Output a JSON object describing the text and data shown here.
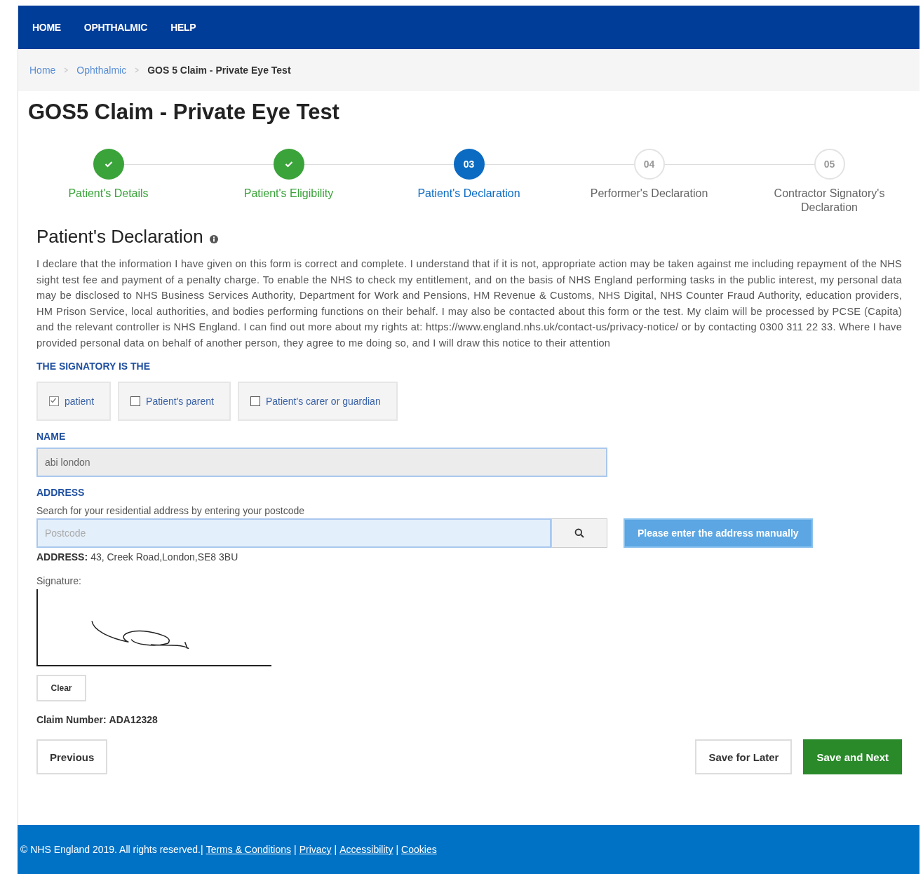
{
  "nav": {
    "items": [
      "HOME",
      "OPHTHALMIC",
      "HELP"
    ]
  },
  "breadcrumb": {
    "items": [
      {
        "label": "Home",
        "current": false
      },
      {
        "label": "Ophthalmic",
        "current": false
      },
      {
        "label": "GOS 5 Claim - Private Eye Test",
        "current": true
      }
    ]
  },
  "title": "GOS5 Claim - Private Eye Test",
  "steps": [
    {
      "label": "Patient's Details",
      "completed": true,
      "selected": false
    },
    {
      "label": "Patient's Eligibility",
      "completed": true,
      "selected": false
    },
    {
      "label": "Patient's Declaration",
      "number": "03",
      "completed": false,
      "selected": true
    },
    {
      "label": "Performer's Declaration",
      "number": "04",
      "completed": false,
      "selected": false
    },
    {
      "label": "Contractor Signatory's Declaration",
      "number": "05",
      "completed": false,
      "selected": false
    }
  ],
  "declaration": {
    "heading": "Patient's Declaration",
    "text": "I declare that the information I have given on this form is correct and complete. I understand that if it is not, appropriate action may be taken against me including repayment of the NHS sight test fee and payment of a penalty charge. To enable the NHS to check my entitlement, and on the basis of NHS England performing tasks in the public interest, my personal data may be disclosed to NHS Business Services Authority, Department for Work and Pensions, HM Revenue & Customs, NHS Digital, NHS Counter Fraud Authority, education providers, HM Prison Service, local authorities, and bodies performing functions on their behalf. I may also be contacted about this form or the test. My claim will be processed by PCSE (Capita) and the relevant controller is NHS England. I can find out more about my rights at: https://www.england.nhs.uk/contact-us/privacy-notice/ or by contacting 0300 311 22 33. Where I have provided personal data on behalf of another person, they agree to me doing so, and I will draw this notice to their attention"
  },
  "signatory": {
    "label": "THE SIGNATORY IS THE",
    "options": [
      {
        "label": "patient",
        "checked": true
      },
      {
        "label": "Patient's parent",
        "checked": false
      },
      {
        "label": "Patient's carer or guardian",
        "checked": false
      }
    ]
  },
  "name": {
    "label": "NAME",
    "value": "abi london"
  },
  "address": {
    "label": "ADDRESS",
    "hint": "Search for your residential address by entering your postcode",
    "placeholder": "Postcode",
    "manual_button": "Please enter the address manually",
    "result_label": "ADDRESS:",
    "result_value": "43, Creek Road,London,SE8 3BU"
  },
  "signature": {
    "label": "Signature:",
    "clear_button": "Clear"
  },
  "claim_number": {
    "label": "Claim Number:",
    "value": "ADA12328"
  },
  "buttons": {
    "previous": "Previous",
    "save_later": "Save for Later",
    "save_next": "Save and Next"
  },
  "footer": {
    "copyright": "© NHS England 2019. All rights reserved.|",
    "separator": "|",
    "links": [
      "Terms & Conditions",
      "Privacy",
      "Accessibility",
      "Cookies"
    ]
  }
}
